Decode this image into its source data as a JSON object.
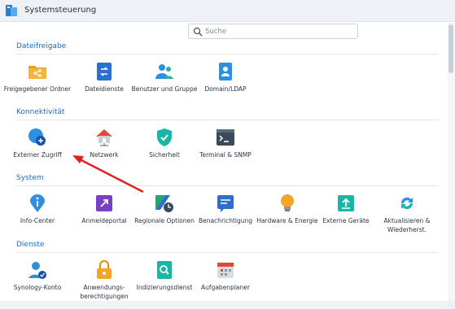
{
  "window": {
    "title": "Systemsteuerung"
  },
  "search": {
    "placeholder": "Suche"
  },
  "sections": [
    {
      "title": "Dateifreigabe",
      "items": [
        {
          "label": "Freigegebener Ordner",
          "icon": "folder-share-icon"
        },
        {
          "label": "Dateidienste",
          "icon": "file-services-icon"
        },
        {
          "label": "Benutzer und Gruppe",
          "icon": "user-group-icon"
        },
        {
          "label": "Domain/LDAP",
          "icon": "domain-ldap-icon"
        }
      ]
    },
    {
      "title": "Konnektivität",
      "items": [
        {
          "label": "Externer Zugriff",
          "icon": "external-access-icon"
        },
        {
          "label": "Netzwerk",
          "icon": "network-house-icon"
        },
        {
          "label": "Sicherheit",
          "icon": "security-shield-icon"
        },
        {
          "label": "Terminal & SNMP",
          "icon": "terminal-icon"
        }
      ]
    },
    {
      "title": "System",
      "items": [
        {
          "label": "Info-Center",
          "icon": "info-center-icon"
        },
        {
          "label": "Anmeldeportal",
          "icon": "login-portal-icon"
        },
        {
          "label": "Regionale Optionen",
          "icon": "regional-options-icon"
        },
        {
          "label": "Benachrichtigung",
          "icon": "notification-icon"
        },
        {
          "label": "Hardware & Energie",
          "icon": "hardware-power-icon"
        },
        {
          "label": "Externe Geräte",
          "icon": "external-devices-icon"
        },
        {
          "label": "Aktualisieren & Wiederherst.",
          "icon": "update-restore-icon"
        }
      ]
    },
    {
      "title": "Dienste",
      "items": [
        {
          "label": "Synology-Konto",
          "icon": "synology-account-icon"
        },
        {
          "label": "Anwendungs-berechtigungen",
          "icon": "app-permissions-icon"
        },
        {
          "label": "Indizierungsdienst",
          "icon": "indexing-service-icon"
        },
        {
          "label": "Aufgabenplaner",
          "icon": "task-scheduler-icon"
        }
      ]
    }
  ],
  "annotation": {
    "color": "#e0201a",
    "target": "Externer Zugriff"
  }
}
